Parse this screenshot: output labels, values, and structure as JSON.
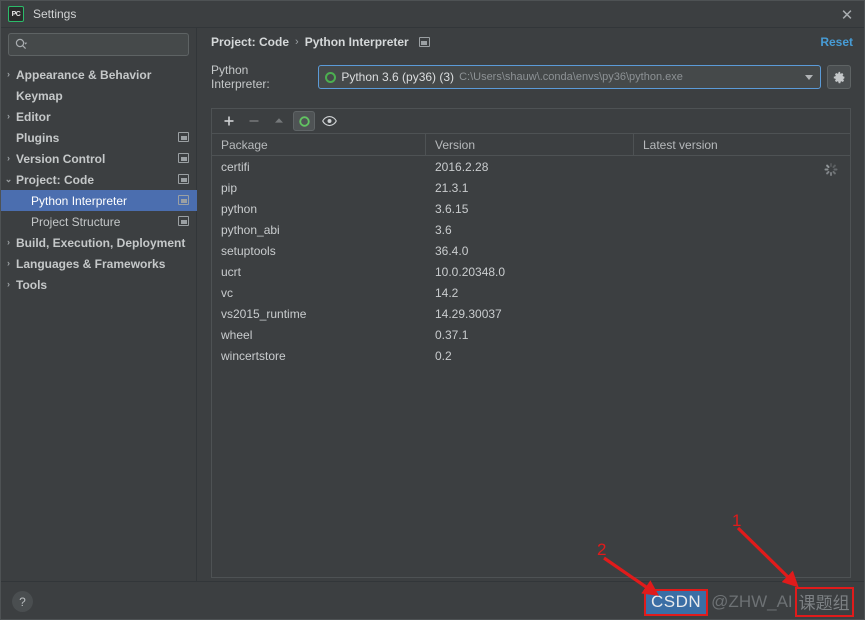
{
  "window": {
    "title": "Settings",
    "logo_icon": "pycharm-logo-icon",
    "close_icon": "close-icon"
  },
  "sidebar": {
    "search": {
      "placeholder": "",
      "value": "",
      "icon": "search-icon",
      "dropdown_icon": "chevron-down-icon"
    },
    "items": [
      {
        "label": "Appearance & Behavior",
        "arrow": "›",
        "indent": 0,
        "bold": true,
        "selected": false,
        "badge": false
      },
      {
        "label": "Keymap",
        "arrow": "",
        "indent": 0,
        "bold": true,
        "selected": false,
        "badge": false
      },
      {
        "label": "Editor",
        "arrow": "›",
        "indent": 0,
        "bold": true,
        "selected": false,
        "badge": false
      },
      {
        "label": "Plugins",
        "arrow": "",
        "indent": 0,
        "bold": true,
        "selected": false,
        "badge": true
      },
      {
        "label": "Version Control",
        "arrow": "›",
        "indent": 0,
        "bold": true,
        "selected": false,
        "badge": true
      },
      {
        "label": "Project: Code",
        "arrow": "⌄",
        "indent": 0,
        "bold": true,
        "selected": false,
        "badge": true
      },
      {
        "label": "Python Interpreter",
        "arrow": "",
        "indent": 1,
        "bold": false,
        "selected": true,
        "badge": true
      },
      {
        "label": "Project Structure",
        "arrow": "",
        "indent": 1,
        "bold": false,
        "selected": false,
        "badge": true
      },
      {
        "label": "Build, Execution, Deployment",
        "arrow": "›",
        "indent": 0,
        "bold": true,
        "selected": false,
        "badge": false
      },
      {
        "label": "Languages & Frameworks",
        "arrow": "›",
        "indent": 0,
        "bold": true,
        "selected": false,
        "badge": false
      },
      {
        "label": "Tools",
        "arrow": "›",
        "indent": 0,
        "bold": true,
        "selected": false,
        "badge": false
      }
    ]
  },
  "main": {
    "breadcrumb": {
      "root": "Project: Code",
      "separator": "›",
      "leaf": "Python Interpreter",
      "badge_icon": "settings-modified-badge-icon"
    },
    "reset_label": "Reset",
    "interpreter": {
      "label": "Python Interpreter:",
      "status_icon": "green-circle-icon",
      "name": "Python 3.6 (py36) (3)",
      "path": "C:\\Users\\shauw\\.conda\\envs\\py36\\python.exe",
      "dropdown_icon": "chevron-down-icon",
      "gear_icon": "gear-icon"
    },
    "toolbar": [
      {
        "name": "add-package-button",
        "glyph": "+",
        "state": "enabled"
      },
      {
        "name": "remove-package-button",
        "glyph": "−",
        "state": "disabled"
      },
      {
        "name": "upgrade-package-button",
        "glyph": "▲",
        "state": "disabled"
      },
      {
        "name": "conda-environment-button",
        "glyph": "circle",
        "state": "active"
      },
      {
        "name": "show-early-releases-button",
        "glyph": "eye",
        "state": "enabled"
      }
    ],
    "table": {
      "columns": [
        "Package",
        "Version",
        "Latest version"
      ],
      "loading_icon": "loading-spinner-icon",
      "rows": [
        {
          "package": "certifi",
          "version": "2016.2.28",
          "latest": ""
        },
        {
          "package": "pip",
          "version": "21.3.1",
          "latest": ""
        },
        {
          "package": "python",
          "version": "3.6.15",
          "latest": ""
        },
        {
          "package": "python_abi",
          "version": "3.6",
          "latest": ""
        },
        {
          "package": "setuptools",
          "version": "36.4.0",
          "latest": ""
        },
        {
          "package": "ucrt",
          "version": "10.0.20348.0",
          "latest": ""
        },
        {
          "package": "vc",
          "version": "14.2",
          "latest": ""
        },
        {
          "package": "vs2015_runtime",
          "version": "14.29.30037",
          "latest": ""
        },
        {
          "package": "wheel",
          "version": "0.37.1",
          "latest": ""
        },
        {
          "package": "wincertstore",
          "version": "0.2",
          "latest": ""
        }
      ]
    }
  },
  "bottom": {
    "help_icon": "help-question-icon",
    "help_label": "?"
  },
  "watermark": {
    "brand": "CSDN",
    "handle": "@ZHW_AI",
    "suffix": "课题组"
  },
  "annotations": [
    {
      "number": "1",
      "target": "watermark-suffix"
    },
    {
      "number": "2",
      "target": "watermark-brand"
    }
  ],
  "colors": {
    "accent": "#4b6eaf",
    "link": "#479cd6",
    "background": "#3c3f41",
    "annotation": "#e01b1b",
    "interpreter_ok": "#4caf50"
  }
}
